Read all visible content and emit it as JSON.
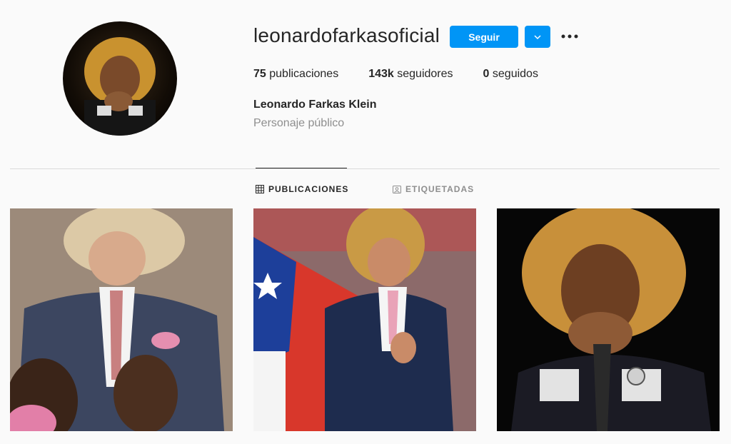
{
  "profile": {
    "username": "leonardofarkasoficial",
    "full_name": "Leonardo Farkas Klein",
    "category": "Personaje público"
  },
  "actions": {
    "follow_label": "Seguir"
  },
  "stats": [
    {
      "count": "75",
      "label": "publicaciones"
    },
    {
      "count": "143k",
      "label": "seguidores"
    },
    {
      "count": "0",
      "label": "seguidos"
    }
  ],
  "tabs": [
    {
      "label": "PUBLICACIONES",
      "icon": "grid-icon",
      "active": true
    },
    {
      "label": "ETIQUETADAS",
      "icon": "tagged-icon",
      "active": false
    }
  ],
  "colors": {
    "accent": "#0095f6",
    "text": "#262626",
    "muted": "#8e8e8e",
    "background": "#fafafa"
  }
}
